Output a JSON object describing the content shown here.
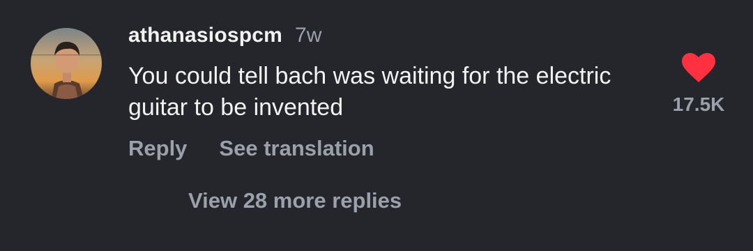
{
  "comment": {
    "username": "athanasiospcm",
    "timestamp": "7w",
    "text": "You could tell bach was waiting for the electric guitar to be invented",
    "avatar_icon": "user-avatar-photo",
    "actions": {
      "reply_label": "Reply",
      "translate_label": "See translation"
    },
    "likes": {
      "icon": "heart-icon",
      "liked": true,
      "color": "#ff3040",
      "count": "17.5K"
    },
    "replies": {
      "label": "View 28 more replies"
    }
  }
}
